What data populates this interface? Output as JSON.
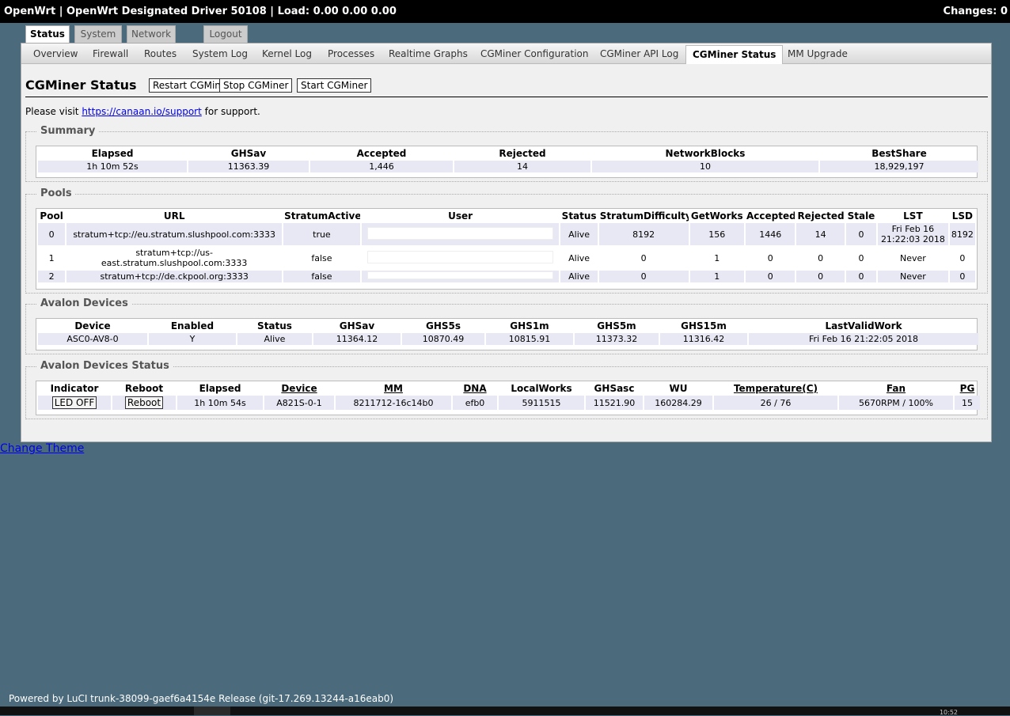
{
  "topbar": {
    "title": "OpenWrt | OpenWrt Designated Driver 50108 | Load: 0.00 0.00 0.00",
    "changes": "Changes: 0"
  },
  "main_tabs": [
    "Status",
    "System",
    "Network",
    "Logout"
  ],
  "active_main_tab": "Status",
  "sub_tabs": [
    "Overview",
    "Firewall",
    "Routes",
    "System Log",
    "Kernel Log",
    "Processes",
    "Realtime Graphs",
    "CGMiner Configuration",
    "CGMiner API Log",
    "CGMiner Status",
    "MM Upgrade"
  ],
  "active_sub_tab": "CGMiner Status",
  "page": {
    "title": "CGMiner Status",
    "buttons": [
      "Restart CGMiner",
      "Stop CGMiner",
      "Start CGMiner"
    ],
    "visit_prefix": "Please visit",
    "visit_link": "https://canaan.io/support",
    "visit_suffix": "for support."
  },
  "summary": {
    "legend": "Summary",
    "headers": [
      "Elapsed",
      "GHSav",
      "Accepted",
      "Rejected",
      "NetworkBlocks",
      "BestShare"
    ],
    "rows": [
      [
        "1h 10m 52s",
        "11363.39",
        "1,446",
        "14",
        "10",
        "18,929,197"
      ]
    ]
  },
  "pools": {
    "legend": "Pools",
    "headers": [
      "Pool",
      "URL",
      "StratumActive",
      "User",
      "Status",
      "StratumDifficulty",
      "GetWorks",
      "Accepted",
      "Rejected",
      "Stale",
      "LST",
      "LSD"
    ],
    "rows": [
      [
        "0",
        "stratum+tcp://eu.stratum.slushpool.com:3333",
        "true",
        "",
        "Alive",
        "8192",
        "156",
        "1446",
        "14",
        "0",
        "Fri Feb 16 21:22:03 2018",
        "8192"
      ],
      [
        "1",
        "stratum+tcp://us-east.stratum.slushpool.com:3333",
        "false",
        "",
        "Alive",
        "0",
        "1",
        "0",
        "0",
        "0",
        "Never",
        "0"
      ],
      [
        "2",
        "stratum+tcp://de.ckpool.org:3333",
        "false",
        "",
        "Alive",
        "0",
        "1",
        "0",
        "0",
        "0",
        "Never",
        "0"
      ]
    ]
  },
  "avalon_devices": {
    "legend": "Avalon Devices",
    "headers": [
      "Device",
      "Enabled",
      "Status",
      "GHSav",
      "GHS5s",
      "GHS1m",
      "GHS5m",
      "GHS15m",
      "LastValidWork"
    ],
    "rows": [
      [
        "ASC0-AV8-0",
        "Y",
        "Alive",
        "11364.12",
        "10870.49",
        "10815.91",
        "11373.32",
        "11316.42",
        "Fri Feb 16 21:22:05 2018"
      ]
    ]
  },
  "avalon_status": {
    "legend": "Avalon Devices Status",
    "headers": [
      "Indicator",
      "Reboot",
      "Elapsed",
      "Device",
      "MM",
      "DNA",
      "LocalWorks",
      "GHSasc",
      "WU",
      "Temperature(C)",
      "Fan",
      "PG"
    ],
    "rows": [
      [
        "LED OFF",
        "Reboot",
        "1h 10m 54s",
        "A821S-0-1",
        "8211712-16c14b0",
        "efb0",
        "5911515",
        "11521.90",
        "160284.29",
        "26 / 76",
        "5670RPM / 100%",
        "15"
      ]
    ]
  },
  "change_theme": "Change Theme",
  "footer": "Powered by LuCI trunk-38099-gaef6a4154e Release (git-17.269.13244-a16eab0)",
  "taskbar_clock": "10:52"
}
